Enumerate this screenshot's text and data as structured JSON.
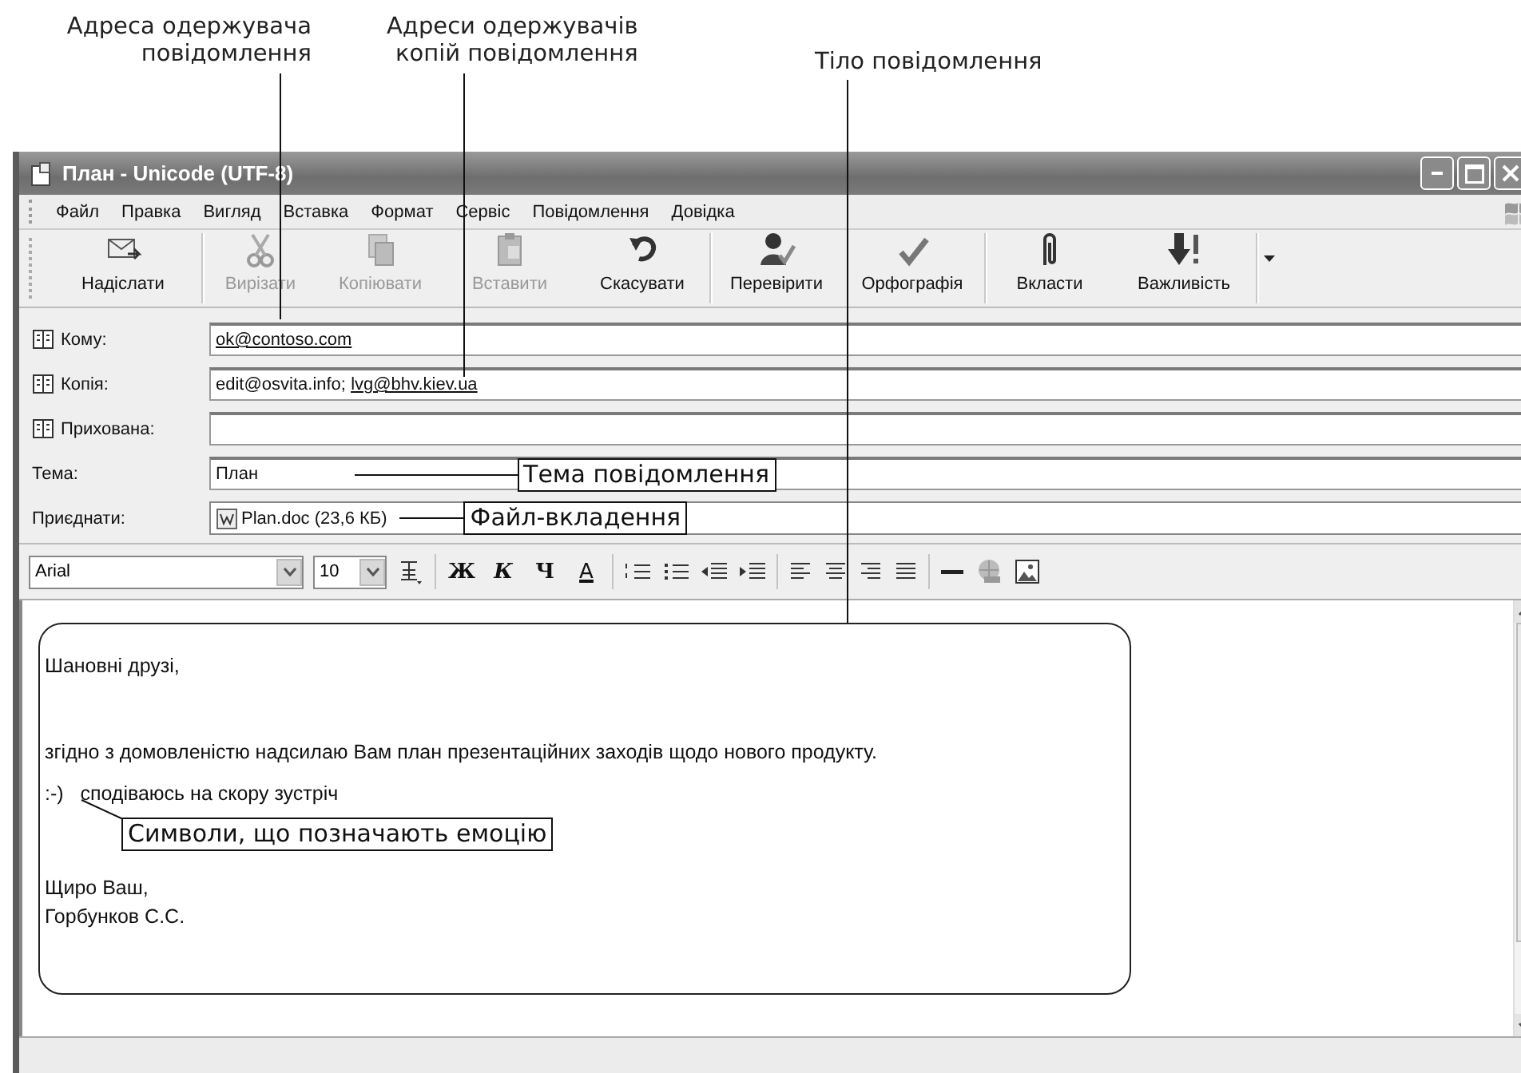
{
  "captions": [
    {
      "lines": [
        "Адреса одержувача",
        "повідомлення"
      ]
    },
    {
      "lines": [
        "Адреси одержувачів",
        "копій повідомлення"
      ]
    },
    {
      "lines": [
        "Тіло повідомлення"
      ]
    }
  ],
  "window": {
    "title": "План - Unicode (UTF-8)"
  },
  "menu": [
    "Файл",
    "Правка",
    "Вигляд",
    "Вставка",
    "Формат",
    "Сервіс",
    "Повідомлення",
    "Довідка"
  ],
  "toolbar": [
    {
      "label": "Надіслати",
      "kind": "send",
      "disabled": false
    },
    {
      "label": "Вирізати",
      "kind": "cut",
      "disabled": true
    },
    {
      "label": "Копіювати",
      "kind": "copy",
      "disabled": true
    },
    {
      "label": "Вставити",
      "kind": "paste",
      "disabled": true
    },
    {
      "label": "Скасувати",
      "kind": "undo",
      "disabled": false
    },
    {
      "label": "Перевірити",
      "kind": "check",
      "disabled": false
    },
    {
      "label": "Орфографія",
      "kind": "spelling",
      "disabled": false
    },
    {
      "label": "Вкласти",
      "kind": "attach",
      "disabled": false
    },
    {
      "label": "Важливість",
      "kind": "priority",
      "disabled": false
    }
  ],
  "headers": [
    {
      "label": "Кому:",
      "kind": "address",
      "addresses": [
        {
          "text": "ok@contoso.com",
          "resolved": true
        }
      ]
    },
    {
      "label": "Копія:",
      "kind": "address",
      "addresses": [
        {
          "text": "edit@osvita.info;",
          "resolved": false
        },
        {
          "text": "lvg@bhv.kiev.ua",
          "resolved": true
        }
      ]
    },
    {
      "label": "Прихована:",
      "kind": "address"
    },
    {
      "label": "Тема:",
      "kind": "text",
      "value": "План",
      "callout": "Тема повідомлення"
    },
    {
      "label": "Приєднати:",
      "kind": "attachment",
      "value": "Plan.doc (23,6 КБ)",
      "callout": "Файл-вкладення"
    }
  ],
  "format_bar": {
    "font": "Arial",
    "size": "10",
    "styles": [
      {
        "text": "Ж",
        "kind": "bold"
      },
      {
        "text": "К",
        "kind": "italic"
      },
      {
        "text": "Ч",
        "kind": "underline"
      },
      {
        "text": "A",
        "kind": "color"
      }
    ]
  },
  "body": {
    "paragraphs": [
      {
        "lines": [
          "Шановні друзі,"
        ]
      },
      {
        "lines": [
          "згідно з домовленістю надсилаю Вам план презентаційних заходів щодо нового продукту."
        ]
      },
      {
        "lines": [
          ":-)   сподіваюсь на скору зустріч"
        ],
        "kind": "emoticon"
      },
      {
        "lines": [
          "Щиро Ваш,",
          "Горбунков С.С."
        ]
      }
    ],
    "callout": "Символи, що позначають емоцію"
  }
}
